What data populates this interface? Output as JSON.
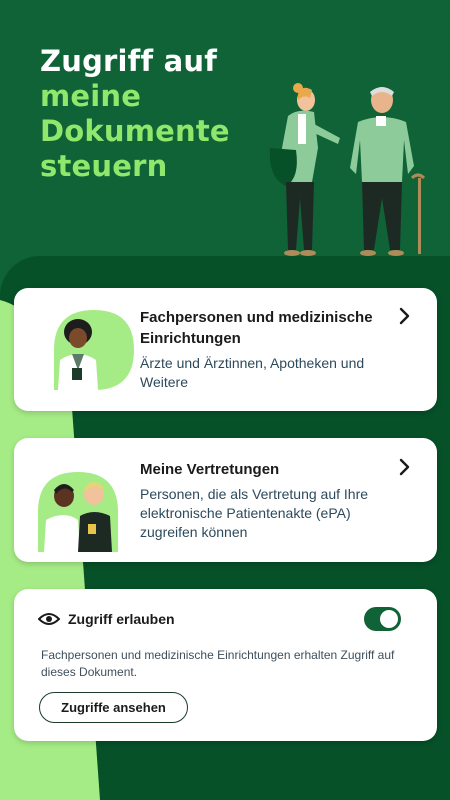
{
  "hero": {
    "title_line1_white": "Zugriff auf ",
    "title_line1_accent": "meine",
    "title_line2_accent": "Dokumente",
    "title_line3_accent": "steuern"
  },
  "cards": [
    {
      "title": "Fachpersonen und medizinische Einrichtungen",
      "description": "Ärzte und Ärztinnen, Apotheken und Weitere",
      "icon": "doctor-avatar",
      "chevron": "chevron-right-icon"
    },
    {
      "title": "Meine Vertretungen",
      "description": "Personen, die als Vertretung auf Ihre elektronische Patientenakte (ePA) zugreifen können",
      "icon": "representatives-avatar",
      "chevron": "chevron-right-icon"
    }
  ],
  "access": {
    "label": "Zugriff erlauben",
    "icon": "eye-icon",
    "toggle_on": true,
    "description": "Fachpersonen und medizinische Einrichtungen erhalten Zugriff auf dieses Dokument.",
    "button_label": "Zugriffe ansehen"
  },
  "colors": {
    "hero_bg": "#0f6337",
    "panel_bg": "#065128",
    "accent": "#8fe86c",
    "toggle": "#0f6337",
    "light_green": "#a6ec86"
  }
}
